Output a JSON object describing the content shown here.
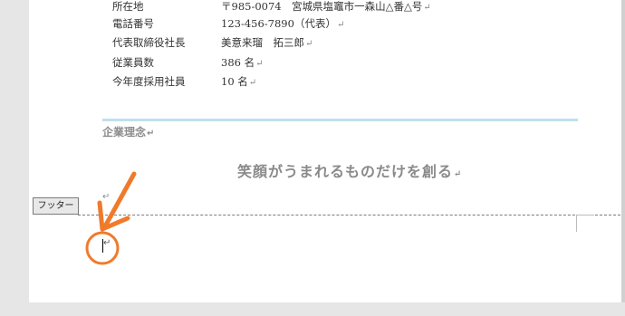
{
  "company_info": [
    {
      "label": "所在地",
      "value": "〒985-0074　宮城県塩竈市一森山△番△号"
    },
    {
      "label": "電話番号",
      "value": "123-456-7890（代表）"
    },
    {
      "label": "代表取締役社長",
      "value": "美意来瑠　拓三郎"
    },
    {
      "label": "従業員数",
      "value": "386 名"
    },
    {
      "label": "今年度採用社員",
      "value": "10 名"
    }
  ],
  "paragraph_mark": "↵",
  "section": {
    "heading": "企業理念",
    "motto": "笑顔がうまれるものだけを創る"
  },
  "footer": {
    "tab_label": "フッター"
  },
  "annotation": {
    "color": "#f07a2c",
    "icons": [
      "arrow-icon",
      "circle-highlight-icon"
    ]
  },
  "colors": {
    "section_rule": "#bfe0ec",
    "canvas_background": "#e6e6e6",
    "page_background": "#ffffff"
  }
}
